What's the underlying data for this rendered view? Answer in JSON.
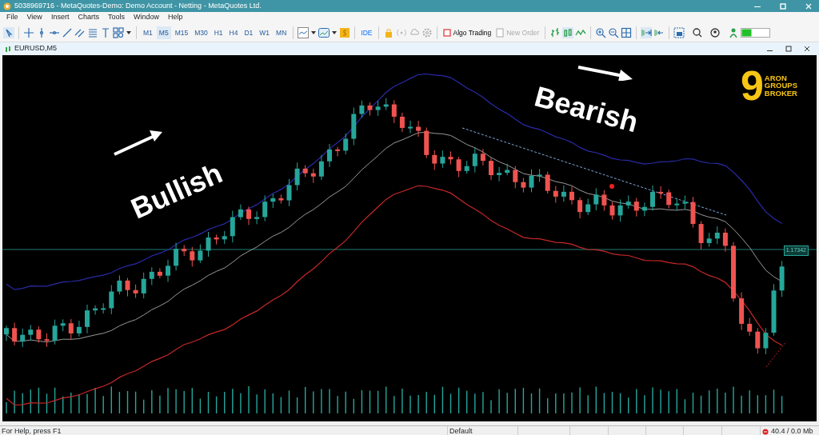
{
  "window": {
    "title": "5038969716 - MetaQuotes-Demo: Demo Account - Netting - MetaQuotes Ltd."
  },
  "menu": [
    "File",
    "View",
    "Insert",
    "Charts",
    "Tools",
    "Window",
    "Help"
  ],
  "timeframes": [
    {
      "label": "M1",
      "selected": false
    },
    {
      "label": "M5",
      "selected": true
    },
    {
      "label": "M15",
      "selected": false
    },
    {
      "label": "M30",
      "selected": false
    },
    {
      "label": "H1",
      "selected": false
    },
    {
      "label": "H4",
      "selected": false
    },
    {
      "label": "D1",
      "selected": false
    },
    {
      "label": "W1",
      "selected": false
    },
    {
      "label": "MN",
      "selected": false
    }
  ],
  "toolbar": {
    "ide": "IDE",
    "algo_trading": "Algo Trading",
    "new_order": {
      "label": "New Order",
      "disabled": true
    }
  },
  "chart_window": {
    "title": "EURUSD,M5",
    "annotations": [
      {
        "text": "Bullish",
        "kind": "up"
      },
      {
        "text": "Bearish",
        "kind": "down"
      }
    ],
    "price_label": "1.17342",
    "logo": {
      "digit": "9",
      "lines": [
        "ARON",
        "GROUPS",
        "BROKER"
      ]
    }
  },
  "status_bar": {
    "help": "For Help, press F1",
    "profile": "Default",
    "memory": "40.4 / 0.0 Mb"
  }
}
